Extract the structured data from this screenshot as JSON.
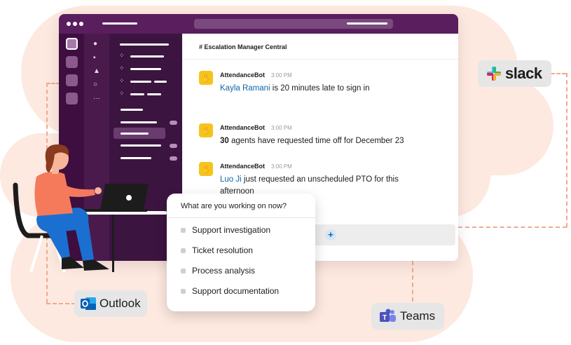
{
  "channel": {
    "name": "# Escalation Manager Central"
  },
  "messages": [
    {
      "sender": "AttendanceBot",
      "time": "3:00 PM",
      "lead": "Kayla Ramani",
      "rest": " is 20 minutes late to sign in"
    },
    {
      "sender": "AttendanceBot",
      "time": "3:00 PM",
      "lead": "30",
      "rest": " agents have requested time off for December 23"
    },
    {
      "sender": "AttendanceBot",
      "time": "3:00 PM",
      "lead": "Luo Ji",
      "rest": " just requested an unscheduled PTO for this afternoon"
    }
  ],
  "composer": {
    "icon": "plus-icon"
  },
  "popup": {
    "question": "What are you working on now?",
    "options": [
      "Support investigation",
      "Ticket resolution",
      "Process analysis",
      "Support documentation"
    ]
  },
  "integrations": {
    "slack": "slack",
    "outlook": "Outlook",
    "teams": "Teams"
  },
  "colors": {
    "titlebar": "#5a1e5e",
    "sidebar": "#3c1440",
    "link": "#1264a3",
    "blob": "#fde9df",
    "connector": "#f0a98f",
    "bot_avatar": "#f6c31b"
  }
}
